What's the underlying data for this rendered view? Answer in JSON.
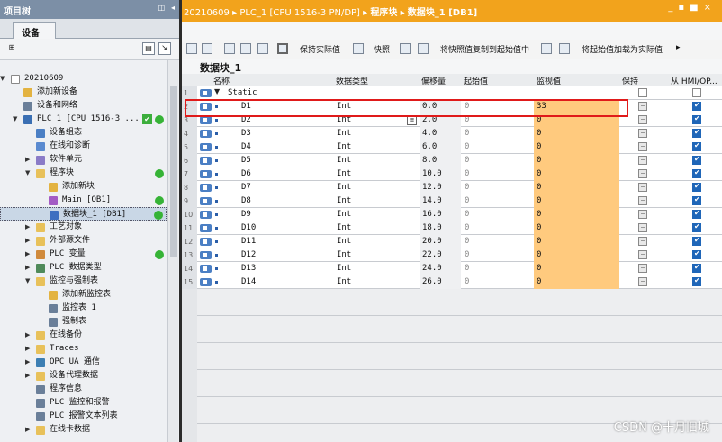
{
  "left_panel": {
    "title": "项目树",
    "devices_tab": "设备",
    "tree": [
      {
        "label": "20210609",
        "level": 0,
        "expander": "▼",
        "icon": "doc-icon",
        "ok": false,
        "dot": false
      },
      {
        "label": "添加新设备",
        "level": 1,
        "expander": "",
        "icon": "add-device-icon",
        "ok": false,
        "dot": false
      },
      {
        "label": "设备和网络",
        "level": 1,
        "expander": "",
        "icon": "network-icon",
        "ok": false,
        "dot": false
      },
      {
        "label": "PLC_1 [CPU 1516-3 ...",
        "level": 1,
        "expander": "▼",
        "icon": "plc-icon",
        "ok": true,
        "dot": true
      },
      {
        "label": "设备组态",
        "level": 2,
        "expander": "",
        "icon": "config-icon",
        "ok": false,
        "dot": false
      },
      {
        "label": "在线和诊断",
        "level": 2,
        "expander": "",
        "icon": "diagnostics-icon",
        "ok": false,
        "dot": false
      },
      {
        "label": "软件单元",
        "level": 2,
        "expander": "▶",
        "icon": "software-unit-icon",
        "ok": false,
        "dot": false
      },
      {
        "label": "程序块",
        "level": 2,
        "expander": "▼",
        "icon": "folder-icon",
        "ok": false,
        "dot": true
      },
      {
        "label": "添加新块",
        "level": 3,
        "expander": "",
        "icon": "add-block-icon",
        "ok": false,
        "dot": false
      },
      {
        "label": "Main [OB1]",
        "level": 3,
        "expander": "",
        "icon": "ob-icon",
        "ok": false,
        "dot": true
      },
      {
        "label": "数据块_1 [DB1]",
        "level": 3,
        "expander": "",
        "icon": "db-icon",
        "ok": false,
        "dot": true,
        "selected": true
      },
      {
        "label": "工艺对象",
        "level": 2,
        "expander": "▶",
        "icon": "folder-icon",
        "ok": false,
        "dot": false
      },
      {
        "label": "外部源文件",
        "level": 2,
        "expander": "▶",
        "icon": "folder-icon",
        "ok": false,
        "dot": false
      },
      {
        "label": "PLC 变量",
        "level": 2,
        "expander": "▶",
        "icon": "tag-icon",
        "ok": false,
        "dot": true
      },
      {
        "label": "PLC 数据类型",
        "level": 2,
        "expander": "▶",
        "icon": "datatype-icon",
        "ok": false,
        "dot": false
      },
      {
        "label": "监控与强制表",
        "level": 2,
        "expander": "▼",
        "icon": "folder-icon",
        "ok": false,
        "dot": false
      },
      {
        "label": "添加新监控表",
        "level": 3,
        "expander": "",
        "icon": "add-table-icon",
        "ok": false,
        "dot": false
      },
      {
        "label": "监控表_1",
        "level": 3,
        "expander": "",
        "icon": "watch-table-icon",
        "ok": false,
        "dot": false
      },
      {
        "label": "强制表",
        "level": 3,
        "expander": "",
        "icon": "force-table-icon",
        "ok": false,
        "dot": false
      },
      {
        "label": "在线备份",
        "level": 2,
        "expander": "▶",
        "icon": "folder-icon",
        "ok": false,
        "dot": false
      },
      {
        "label": "Traces",
        "level": 2,
        "expander": "▶",
        "icon": "folder-icon",
        "ok": false,
        "dot": false
      },
      {
        "label": "OPC UA 通信",
        "level": 2,
        "expander": "▶",
        "icon": "opc-icon",
        "ok": false,
        "dot": false
      },
      {
        "label": "设备代理数据",
        "level": 2,
        "expander": "▶",
        "icon": "folder-icon",
        "ok": false,
        "dot": false
      },
      {
        "label": "程序信息",
        "level": 2,
        "expander": "",
        "icon": "info-icon",
        "ok": false,
        "dot": false
      },
      {
        "label": "PLC 监控和报警",
        "level": 2,
        "expander": "",
        "icon": "alarm-icon",
        "ok": false,
        "dot": false
      },
      {
        "label": "PLC 报警文本列表",
        "level": 2,
        "expander": "",
        "icon": "text-list-icon",
        "ok": false,
        "dot": false
      },
      {
        "label": "在线卡数据",
        "level": 2,
        "expander": "▶",
        "icon": "folder-icon",
        "ok": false,
        "dot": false
      }
    ]
  },
  "breadcrumb": {
    "items": [
      "20210609",
      "PLC_1 [CPU 1516-3 PN/DP]",
      "程序块",
      "数据块_1 [DB1]"
    ],
    "separator": "▸"
  },
  "window_controls": [
    "_",
    "▪",
    "■",
    "×"
  ],
  "toolbar": {
    "keep_actual": "保持实际值",
    "snapshot": "快照",
    "copy_snapshot": "将快照值复制到起始值中",
    "load_start": "将起始值加载为实际值"
  },
  "block_title": "数据块_1",
  "table": {
    "headers": [
      "名称",
      "数据类型",
      "偏移量",
      "起始值",
      "监视值",
      "保持",
      "从 HMI/OP..."
    ],
    "rows": [
      {
        "num": "1",
        "name": "Static",
        "type": "",
        "offset": "",
        "start": "",
        "monitor": "",
        "static": true
      },
      {
        "num": "2",
        "name": "D1",
        "type": "Int",
        "offset": "0.0",
        "start": "0",
        "monitor": "33"
      },
      {
        "num": "3",
        "name": "D2",
        "type": "Int",
        "offset": "2.0",
        "start": "0",
        "monitor": "0"
      },
      {
        "num": "4",
        "name": "D3",
        "type": "Int",
        "offset": "4.0",
        "start": "0",
        "monitor": "0"
      },
      {
        "num": "5",
        "name": "D4",
        "type": "Int",
        "offset": "6.0",
        "start": "0",
        "monitor": "0"
      },
      {
        "num": "6",
        "name": "D5",
        "type": "Int",
        "offset": "8.0",
        "start": "0",
        "monitor": "0"
      },
      {
        "num": "7",
        "name": "D6",
        "type": "Int",
        "offset": "10.0",
        "start": "0",
        "monitor": "0"
      },
      {
        "num": "8",
        "name": "D7",
        "type": "Int",
        "offset": "12.0",
        "start": "0",
        "monitor": "0"
      },
      {
        "num": "9",
        "name": "D8",
        "type": "Int",
        "offset": "14.0",
        "start": "0",
        "monitor": "0"
      },
      {
        "num": "10",
        "name": "D9",
        "type": "Int",
        "offset": "16.0",
        "start": "0",
        "monitor": "0"
      },
      {
        "num": "11",
        "name": "D10",
        "type": "Int",
        "offset": "18.0",
        "start": "0",
        "monitor": "0"
      },
      {
        "num": "12",
        "name": "D11",
        "type": "Int",
        "offset": "20.0",
        "start": "0",
        "monitor": "0"
      },
      {
        "num": "13",
        "name": "D12",
        "type": "Int",
        "offset": "22.0",
        "start": "0",
        "monitor": "0"
      },
      {
        "num": "14",
        "name": "D13",
        "type": "Int",
        "offset": "24.0",
        "start": "0",
        "monitor": "0"
      },
      {
        "num": "15",
        "name": "D14",
        "type": "Int",
        "offset": "26.0",
        "start": "0",
        "monitor": "0"
      }
    ]
  },
  "watermark": "CSDN @十月旧城",
  "colors": {
    "breadcrumb_bg": "#f2a31c",
    "monitor_cell": "#ffca7e",
    "highlight_box": "#e01a1a",
    "status_ok": "#36b336",
    "left_title_bg": "#7c8fa6"
  }
}
